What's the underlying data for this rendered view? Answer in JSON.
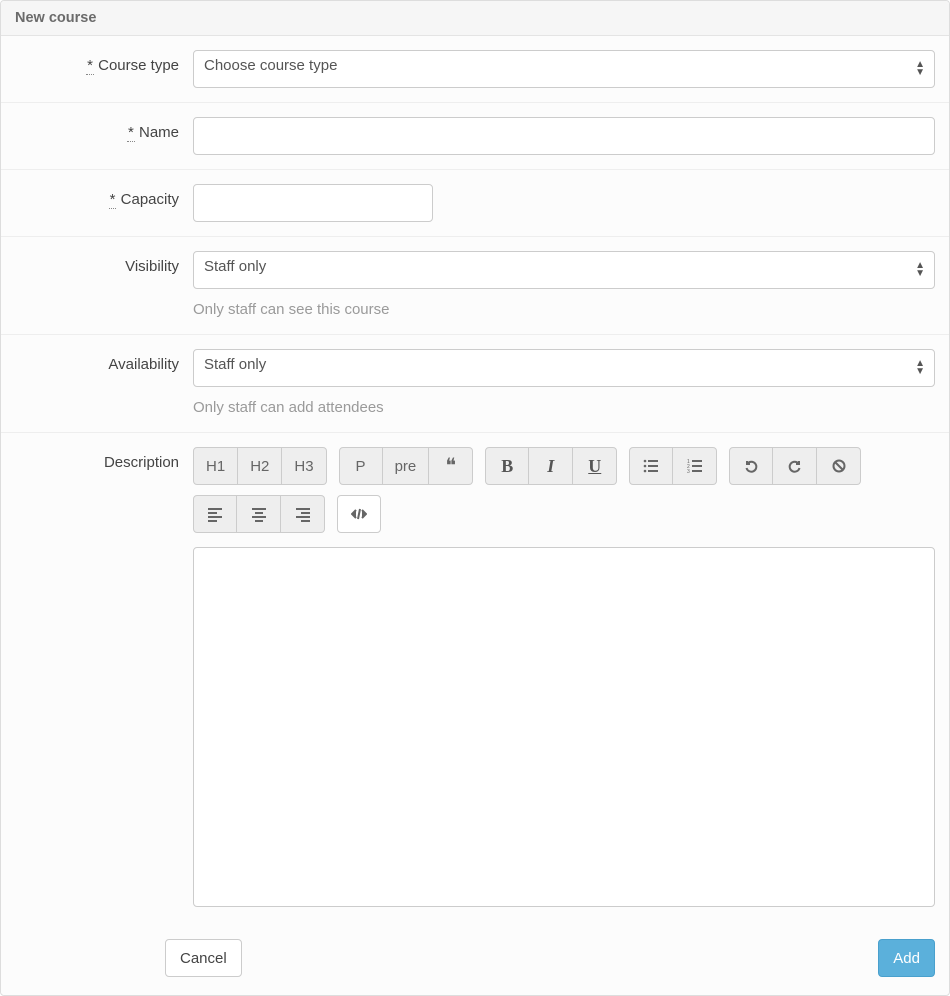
{
  "panel_title": "New course",
  "form": {
    "course_type": {
      "label": "Course type",
      "required_marker": "*",
      "selected": "Choose course type"
    },
    "name": {
      "label": "Name",
      "required_marker": "*",
      "value": ""
    },
    "capacity": {
      "label": "Capacity",
      "required_marker": "*",
      "value": ""
    },
    "visibility": {
      "label": "Visibility",
      "selected": "Staff only",
      "help": "Only staff can see this course"
    },
    "availability": {
      "label": "Availability",
      "selected": "Staff only",
      "help": "Only staff can add attendees"
    },
    "description": {
      "label": "Description",
      "value": ""
    }
  },
  "toolbar": {
    "h1": "H1",
    "h2": "H2",
    "h3": "H3",
    "p": "P",
    "pre": "pre"
  },
  "footer": {
    "cancel_label": "Cancel",
    "add_label": "Add"
  }
}
